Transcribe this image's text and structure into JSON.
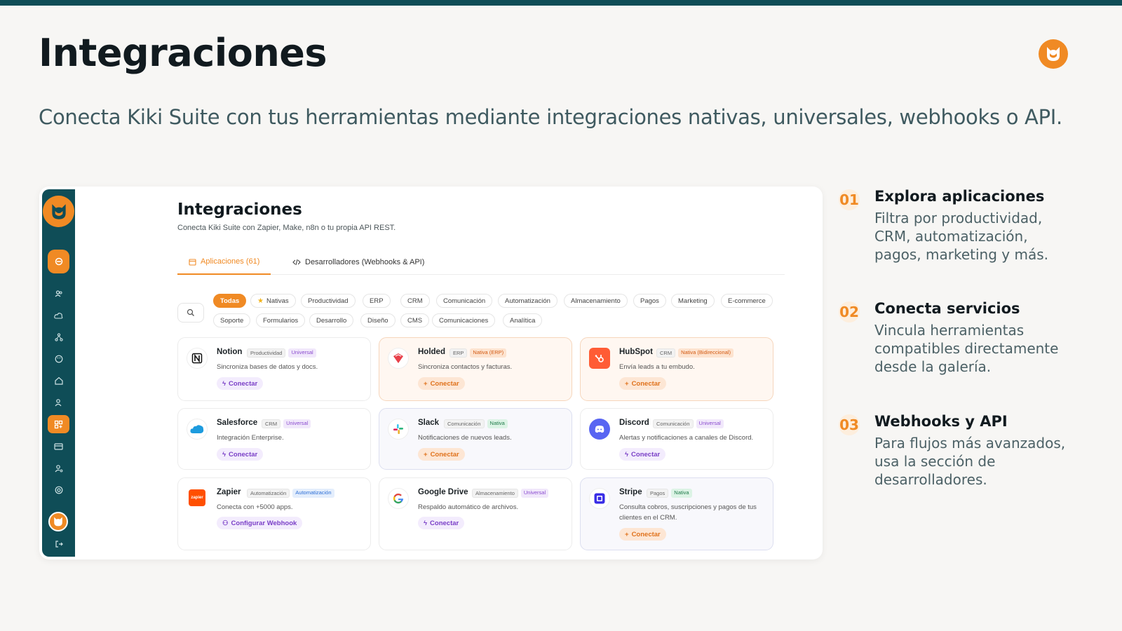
{
  "slide": {
    "title": "Integraciones",
    "subtitle": "Conecta Kiki Suite con tus herramientas mediante integraciones nativas, universales, webhooks o API."
  },
  "colors": {
    "accent": "#f08a24",
    "sidebar": "#0f4d57",
    "topbar": "#0f4d57"
  },
  "app": {
    "title": "Integraciones",
    "subtitle": "Conecta Kiki Suite con Zapier, Make, n8n o tu propia API REST.",
    "tabs": [
      {
        "label": "Aplicaciones (61)",
        "icon": "calendar-icon"
      },
      {
        "label": "Desarrolladores (Webhooks & API)",
        "icon": "code-icon"
      }
    ],
    "filters_row1": [
      "Todas",
      "Nativas",
      "Productividad",
      "ERP",
      "CRM",
      "Comunicación",
      "Automatización",
      "Almacenamiento",
      "Pagos",
      "Marketing",
      "E-commerce"
    ],
    "filters_row2": [
      "Soporte",
      "Formularios",
      "Desarrollo",
      "Diseño",
      "CMS",
      "Comunicaciones",
      "Analítica"
    ],
    "cards": [
      {
        "name": "Notion",
        "category": "Productividad",
        "badge": "Universal",
        "desc": "Sincroniza bases de datos y docs.",
        "button": "Conectar"
      },
      {
        "name": "Holded",
        "category": "ERP",
        "badge": "Nativa (ERP)",
        "desc": "Sincroniza contactos y facturas.",
        "button": "Conectar"
      },
      {
        "name": "HubSpot",
        "category": "CRM",
        "badge": "Nativa (Bidireccional)",
        "desc": "Envía leads a tu embudo.",
        "button": "Conectar"
      },
      {
        "name": "Salesforce",
        "category": "CRM",
        "badge": "Universal",
        "desc": "Integración Enterprise.",
        "button": "Conectar"
      },
      {
        "name": "Slack",
        "category": "Comunicación",
        "badge": "Nativa",
        "desc": "Notificaciones de nuevos leads.",
        "button": "Conectar"
      },
      {
        "name": "Discord",
        "category": "Comunicación",
        "badge": "Universal",
        "desc": "Alertas y notificaciones a canales de Discord.",
        "button": "Conectar"
      },
      {
        "name": "Zapier",
        "category": "Automatización",
        "badge": "Automatización",
        "desc": "Conecta con +5000 apps.",
        "button": "Configurar Webhook",
        "logo_text": "zapier"
      },
      {
        "name": "Google Drive",
        "category": "Almacenamiento",
        "badge": "Universal",
        "desc": "Respaldo automático de archivos.",
        "button": "Conectar"
      },
      {
        "name": "Stripe",
        "category": "Pagos",
        "badge": "Nativa",
        "desc": "Consulta cobros, suscripciones y pagos de tus clientes en el CRM.",
        "button": "Conectar"
      }
    ]
  },
  "steps": [
    {
      "num": "01",
      "title": "Explora aplicaciones",
      "text": "Filtra por productividad, CRM, automatización, pagos, marketing y más."
    },
    {
      "num": "02",
      "title": "Conecta servicios",
      "text": "Vincula herramientas compatibles directamente desde la galería."
    },
    {
      "num": "03",
      "title": "Webhooks y API",
      "text": "Para flujos más avanzados, usa la sección de desarrolladores."
    }
  ]
}
